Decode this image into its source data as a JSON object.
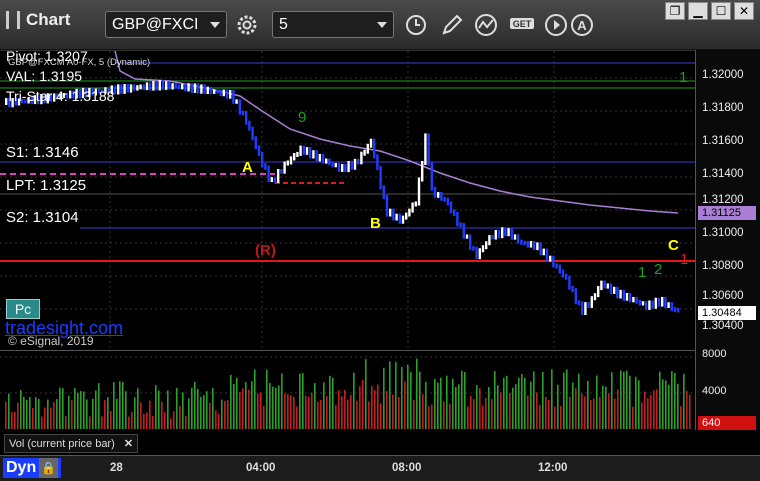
{
  "toolbar": {
    "title": "Chart",
    "symbol": "GBP@FXCI",
    "interval": "5",
    "window_buttons": [
      "restore",
      "minimize",
      "maximize",
      "close"
    ]
  },
  "chart": {
    "subtitle": "GBP@FXCM A0-FX, 5 (Dynamic)",
    "levels": {
      "pivot": "Pivot: 1.3207",
      "val": "VAL: 1.3195",
      "tristar": "Tri-Star 4: 1.3188",
      "s1": "S1: 1.3146",
      "lpt": "LPT: 1.3125",
      "s2": "S2: 1.3104",
      "r": "(R)"
    },
    "markers": {
      "a": "A",
      "b": "B",
      "c": "C"
    },
    "counts": {
      "green_1_top": "1",
      "green_1": "1",
      "green_2": "2",
      "red_1": "1",
      "nine": "9"
    },
    "branding": {
      "site": "tradesight.com",
      "copyright": "© eSignal, 2019",
      "pc_button": "Pc"
    },
    "price_ticks": [
      "1.32000",
      "1.31800",
      "1.31600",
      "1.31400",
      "1.31200",
      "1.31000",
      "1.30800",
      "1.30600",
      "1.30400"
    ],
    "current_price": "1.30484",
    "ma_price": "1.31125",
    "colors": {
      "level_line": "#3b3bd8",
      "pink": "#e040c0",
      "red": "#e01818",
      "up": "#ffffff",
      "down": "#1f3cff",
      "ma": "#a87fd4",
      "green_count": "#1ea01e",
      "marker_yellow": "#ffff00"
    }
  },
  "volume": {
    "label": "Vol (current price bar)",
    "close_icon": "close-icon",
    "ticks": [
      "8000",
      "4000",
      "0"
    ],
    "current": "640"
  },
  "time_axis": {
    "dyn_label": "Dyn",
    "labels": [
      "28",
      "04:00",
      "08:00",
      "12:00"
    ]
  }
}
